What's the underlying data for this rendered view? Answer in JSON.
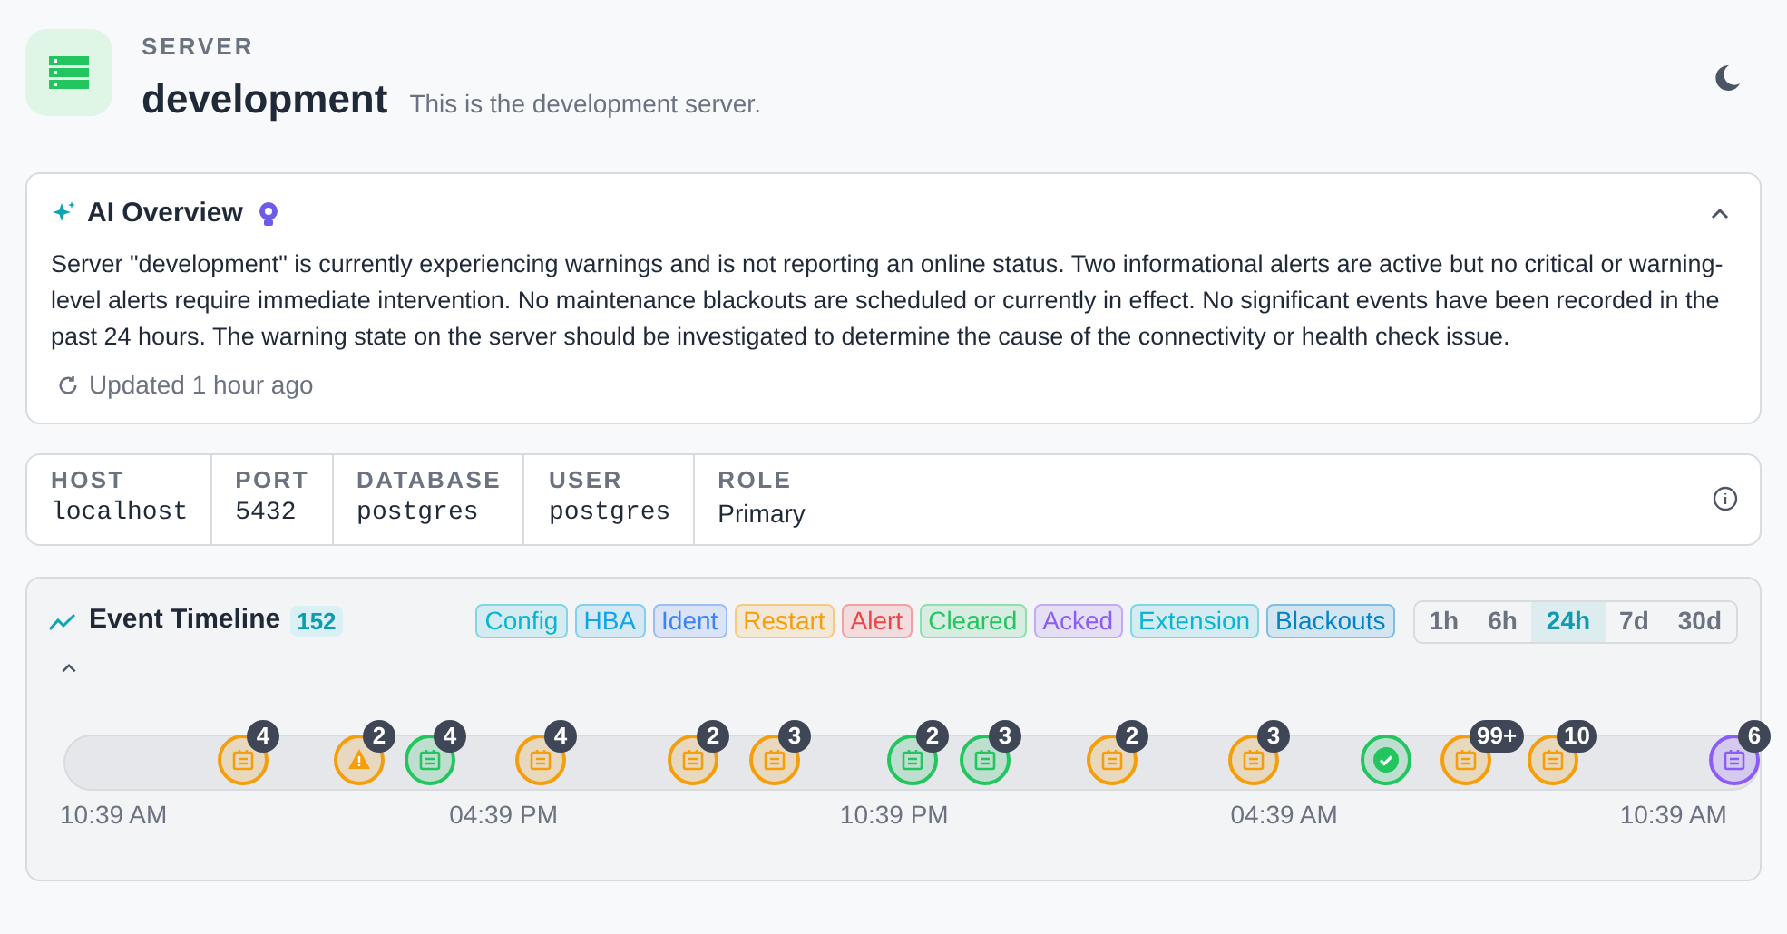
{
  "header": {
    "eyebrow": "SERVER",
    "title": "development",
    "description": "This is the development server."
  },
  "ai_overview": {
    "title": "AI Overview",
    "expanded": true,
    "summary": "Server \"development\" is currently experiencing warnings and is not reporting an online status. Two informational alerts are active but no critical or warning-level alerts require immediate intervention. No maintenance blackouts are scheduled or currently in effect. No significant events have been recorded in the past 24 hours. The warning state on the server should be investigated to determine the cause of the connectivity or health check issue.",
    "updated": "Updated 1 hour ago"
  },
  "connection": [
    {
      "label": "HOST",
      "value": "localhost",
      "kind": "mono"
    },
    {
      "label": "PORT",
      "value": "5432",
      "kind": "mono"
    },
    {
      "label": "DATABASE",
      "value": "postgres",
      "kind": "mono"
    },
    {
      "label": "USER",
      "value": "postgres",
      "kind": "mono"
    },
    {
      "label": "ROLE",
      "value": "Primary",
      "kind": "text"
    }
  ],
  "timeline": {
    "title": "Event Timeline",
    "count": "152",
    "expanded": true,
    "filters": [
      {
        "label": "Config",
        "color": "#06b6d4"
      },
      {
        "label": "HBA",
        "color": "#0ea5e9"
      },
      {
        "label": "Ident",
        "color": "#3b82f6"
      },
      {
        "label": "Restart",
        "color": "#f59e0b"
      },
      {
        "label": "Alert",
        "color": "#ef4444"
      },
      {
        "label": "Cleared",
        "color": "#22c55e"
      },
      {
        "label": "Acked",
        "color": "#8b5cf6"
      },
      {
        "label": "Extension",
        "color": "#06b6d4"
      },
      {
        "label": "Blackouts",
        "color": "#0284c7"
      }
    ],
    "ranges": [
      {
        "label": "1h",
        "selected": false
      },
      {
        "label": "6h",
        "selected": false
      },
      {
        "label": "24h",
        "selected": true
      },
      {
        "label": "7d",
        "selected": false
      },
      {
        "label": "30d",
        "selected": false
      }
    ],
    "markers": [
      {
        "kind": "event",
        "color": "#f59e0b",
        "count": "4"
      },
      {
        "kind": "warning",
        "color": "#f59e0b",
        "count": "2"
      },
      {
        "kind": "event",
        "color": "#22c55e",
        "count": "4"
      },
      {
        "kind": "event",
        "color": "#f59e0b",
        "count": "4"
      },
      {
        "kind": "event",
        "color": "#f59e0b",
        "count": "2"
      },
      {
        "kind": "event",
        "color": "#f59e0b",
        "count": "3"
      },
      {
        "kind": "event",
        "color": "#22c55e",
        "count": "2"
      },
      {
        "kind": "event",
        "color": "#22c55e",
        "count": "3"
      },
      {
        "kind": "event",
        "color": "#f59e0b",
        "count": "2"
      },
      {
        "kind": "event",
        "color": "#f59e0b",
        "count": "3"
      },
      {
        "kind": "check",
        "color": "#22c55e"
      },
      {
        "kind": "event",
        "color": "#f59e0b",
        "count": "99+"
      },
      {
        "kind": "event",
        "color": "#f59e0b",
        "count": "10"
      },
      {
        "kind": "event",
        "color": "#8b5cf6",
        "count": "6"
      }
    ],
    "axis_labels": [
      "10:39 AM",
      "04:39 PM",
      "10:39 PM",
      "04:39 AM",
      "10:39 AM"
    ]
  }
}
